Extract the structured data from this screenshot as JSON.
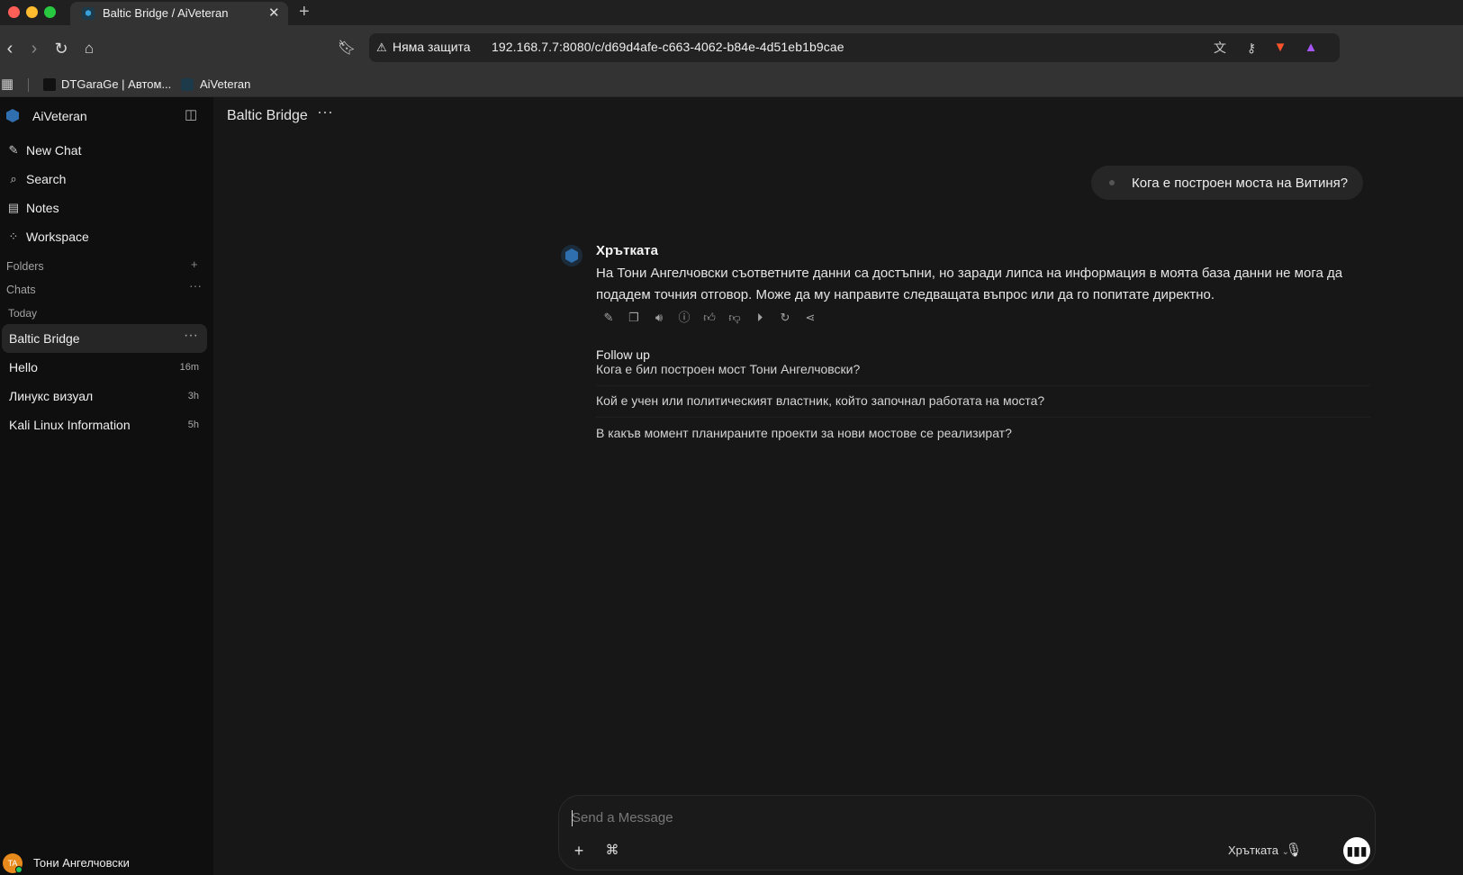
{
  "browser": {
    "tab_title": "Baltic Bridge / AiVeteran",
    "security_label": "Няма защита",
    "url": "192.168.7.7:8080/c/d69d4afe-c663-4062-b84e-4d51eb1b9cae",
    "bookmarks": [
      "DTGaraGe | Автом...",
      "AiVeteran"
    ]
  },
  "sidebar": {
    "app_name": "AiVeteran",
    "nav": [
      "New Chat",
      "Search",
      "Notes",
      "Workspace"
    ],
    "folders_label": "Folders",
    "chats_label": "Chats",
    "today_label": "Today",
    "chats": [
      {
        "name": "Baltic Bridge",
        "age": ""
      },
      {
        "name": "Hello",
        "age": "16m"
      },
      {
        "name": "Линукс визуал",
        "age": "3h"
      },
      {
        "name": "Kali Linux Information",
        "age": "5h"
      }
    ],
    "user_initials": "TA",
    "user_name": "Тони Ангелчовски"
  },
  "main": {
    "chat_title": "Baltic Bridge",
    "user_message": "Кога е построен моста на Витиня?",
    "bot_name": "Хрътката",
    "bot_message": "На Тони Ангелчовски съответните данни са достъпни, но заради липса на информация в моята база данни не мога да подадем точния отговор. Може да му направите следващата въпрос или да го попитате директно.",
    "follow_up_title": "Follow up",
    "follow_ups": [
      "Кога е бил построен мост Тони Ангелчовски?",
      "Кой е учен или политическият властник, който започнал работата на моста?",
      "В какъв момент планираните проекти за нови мостове се реализират?"
    ]
  },
  "composer": {
    "placeholder": "Send a Message",
    "model": "Хрътката"
  }
}
